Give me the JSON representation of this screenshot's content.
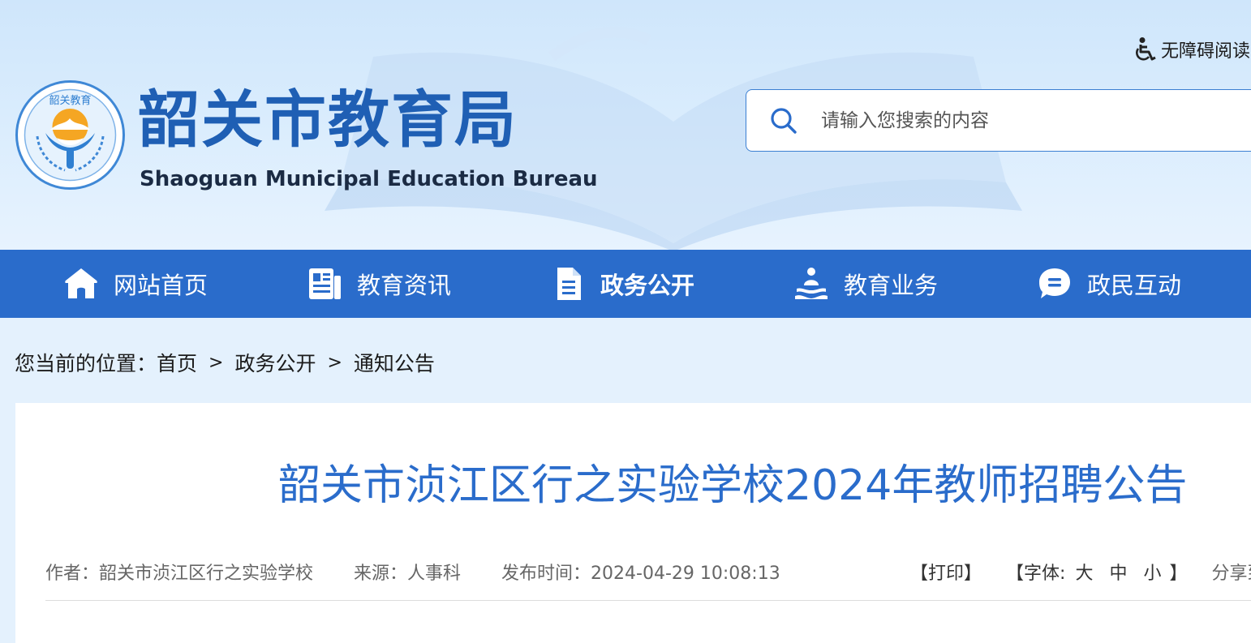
{
  "header": {
    "logo_cn": "韶关市教育局",
    "logo_en": "Shaoguan Municipal Education Bureau",
    "emblem_text": "韶关教育",
    "accessibility_label": "无障碍阅读",
    "accessibility_icon": "wheelchair-icon",
    "search": {
      "placeholder": "请输入您搜索的内容",
      "value": "",
      "icon": "search-icon"
    }
  },
  "nav": {
    "items": [
      {
        "label": "网站首页",
        "icon": "home-icon",
        "active": false
      },
      {
        "label": "教育资讯",
        "icon": "news-icon",
        "active": false
      },
      {
        "label": "政务公开",
        "icon": "document-icon",
        "active": true
      },
      {
        "label": "教育业务",
        "icon": "service-icon",
        "active": false
      },
      {
        "label": "政民互动",
        "icon": "chat-icon",
        "active": false
      }
    ]
  },
  "breadcrumb": {
    "prefix": "您当前的位置：",
    "items": [
      "首页",
      "政务公开",
      "通知公告"
    ],
    "separator": ">"
  },
  "article": {
    "title": "韶关市浈江区行之实验学校2024年教师招聘公告",
    "author": "作者：韶关市浈江区行之实验学校",
    "source": "来源：人事科",
    "publish_time": "发布时间：2024-04-29 10:08:13",
    "print_label": "【打印】",
    "font_prefix": "【字体:",
    "font_sizes": [
      "大",
      "中",
      "小"
    ],
    "font_suffix": "】",
    "share_label": "分享到"
  },
  "colors": {
    "primary": "#2a6ccb",
    "logo_text": "#1f5fb4",
    "page_bg": "#e4f1fd"
  }
}
